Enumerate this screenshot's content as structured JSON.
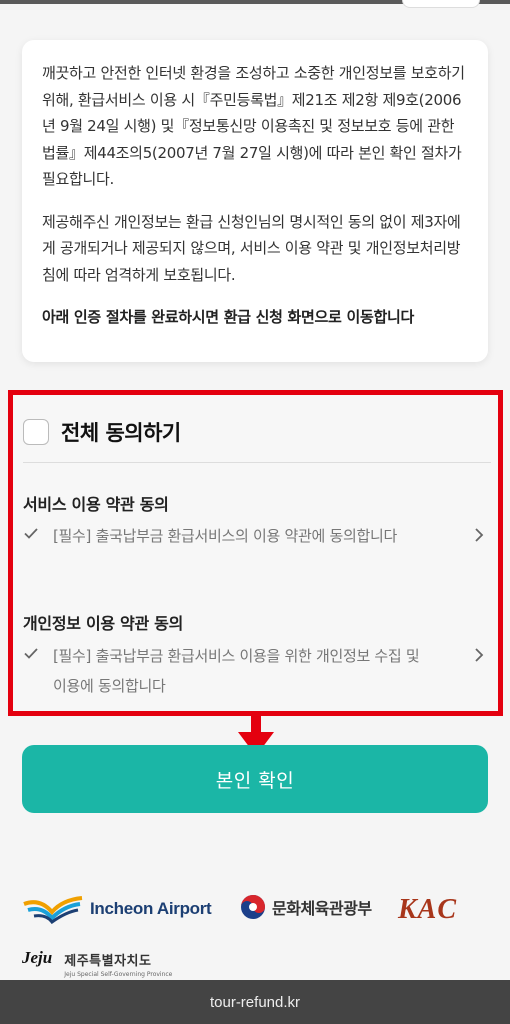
{
  "notice": {
    "paragraph1": "깨끗하고 안전한 인터넷 환경을 조성하고 소중한 개인정보를 보호하기 위해, 환급서비스 이용 시『주민등록법』제21조 제2항 제9호(2006년 9월 24일 시행) 및『정보통신망 이용촉진 및 정보보호 등에 관한 법률』제44조의5(2007년 7월 27일 시행)에 따라 본인 확인 절차가 필요합니다.",
    "paragraph2": "제공해주신 개인정보는 환급 신청인님의 명시적인 동의 없이 제3자에게 공개되거나 제공되지 않으며, 서비스 이용 약관 및 개인정보처리방침에 따라 엄격하게 보호됩니다.",
    "paragraph3": "아래 인증 절차를 완료하시면 환급 신청 화면으로 이동합니다"
  },
  "consent": {
    "agree_all_label": "전체 동의하기",
    "sections": [
      {
        "title": "서비스 이용 약관 동의",
        "item": "[필수] 출국납부금 환급서비스의 이용 약관에 동의합니다"
      },
      {
        "title": "개인정보 이용 약관 동의",
        "item": "[필수] 출국납부금 환급서비스 이용을 위한 개인정보 수집 및 이용에 동의합니다"
      }
    ]
  },
  "confirm_button": "본인 확인",
  "logos": {
    "incheon": "Incheon Airport",
    "mcst": "문화체육관광부",
    "kac": "KAC",
    "jeju_mark": "Jeju",
    "jeju_ko": "제주특별자치도",
    "jeju_en": "Jeju Special Self-Governing Province"
  },
  "footer_url": "tour-refund.kr",
  "colors": {
    "accent": "#1bb6a6",
    "highlight_border": "#e4000f",
    "arrow": "#e4000f"
  }
}
